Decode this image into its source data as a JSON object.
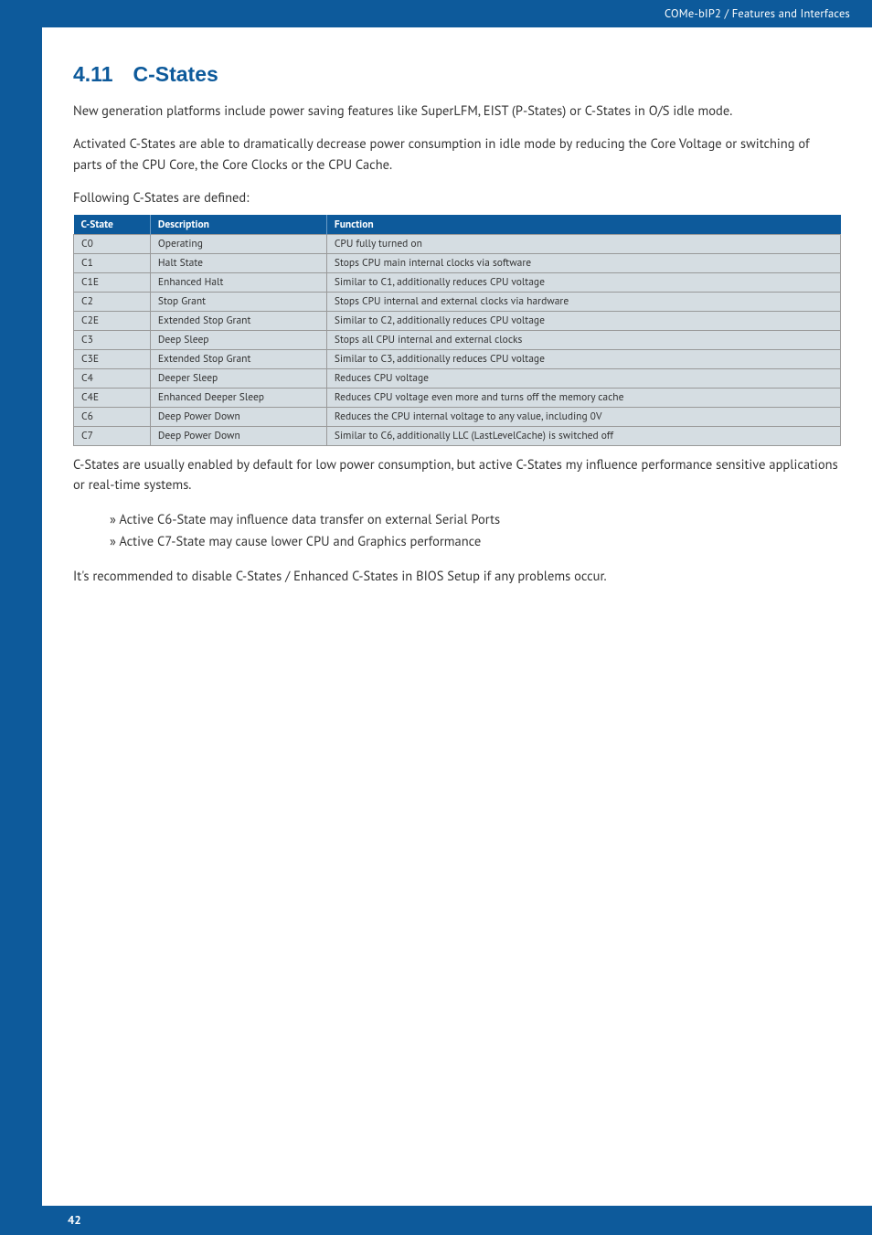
{
  "header": {
    "breadcrumb": "COMe-bIP2 / Features and Interfaces"
  },
  "footer": {
    "page_number": "42"
  },
  "section": {
    "number": "4.11",
    "title": "C-States"
  },
  "paragraphs": {
    "p1": "New generation platforms include power saving features like SuperLFM, EIST (P-States) or C-States in O/S idle mode.",
    "p2": "Activated C-States are able to dramatically decrease power consumption in idle mode by reducing the Core Voltage or switching of parts of the CPU Core, the Core Clocks or the CPU Cache.",
    "p3": "Following C-States are defined:",
    "p4": "C-States are usually enabled by default for low power consumption, but active C-States my influence performance sensitive applications or real-time systems.",
    "p5": "It's recommended to disable C-States / Enhanced C-States in BIOS Setup if any problems occur."
  },
  "table": {
    "headers": {
      "c1": "C-State",
      "c2": "Description",
      "c3": "Function"
    },
    "rows": [
      {
        "c1": "C0",
        "c2": "Operating",
        "c3": "CPU fully turned on"
      },
      {
        "c1": "C1",
        "c2": "Halt State",
        "c3": "Stops CPU main internal clocks via software"
      },
      {
        "c1": "C1E",
        "c2": "Enhanced Halt",
        "c3": "Similar to C1, additionally reduces CPU voltage"
      },
      {
        "c1": "C2",
        "c2": "Stop Grant",
        "c3": "Stops CPU internal and external clocks via hardware"
      },
      {
        "c1": "C2E",
        "c2": "Extended Stop Grant",
        "c3": "Similar to C2, additionally reduces CPU voltage"
      },
      {
        "c1": "C3",
        "c2": "Deep Sleep",
        "c3": "Stops all CPU internal and external clocks"
      },
      {
        "c1": "C3E",
        "c2": "Extended Stop Grant",
        "c3": "Similar to C3, additionally reduces CPU voltage"
      },
      {
        "c1": "C4",
        "c2": "Deeper Sleep",
        "c3": "Reduces CPU voltage"
      },
      {
        "c1": "C4E",
        "c2": "Enhanced Deeper Sleep",
        "c3": "Reduces CPU voltage even more and turns off the memory cache"
      },
      {
        "c1": "C6",
        "c2": "Deep Power Down",
        "c3": "Reduces the CPU internal voltage to any value, including 0V"
      },
      {
        "c1": "C7",
        "c2": "Deep Power Down",
        "c3": "Similar to C6, additionally LLC (LastLevelCache) is switched off"
      }
    ]
  },
  "bullets": {
    "b1": "Active C6-State may influence data transfer on external Serial Ports",
    "b2": "Active C7-State may cause lower CPU and Graphics performance"
  }
}
